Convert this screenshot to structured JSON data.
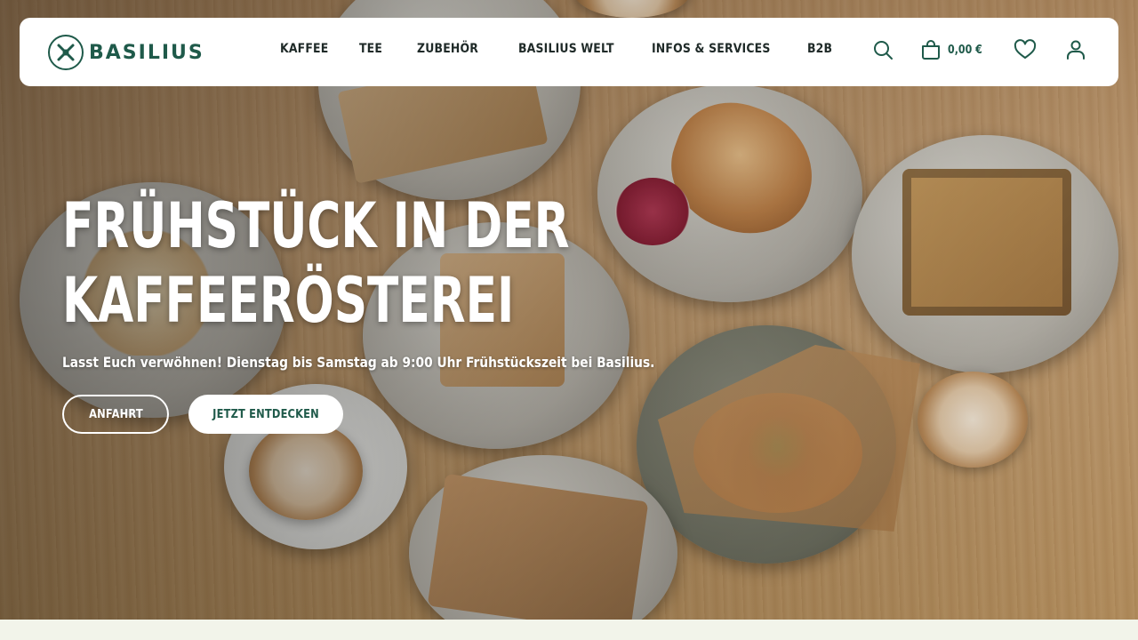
{
  "brand": {
    "name": "BASILIUS",
    "color": "#1f5a4a"
  },
  "nav": {
    "items": [
      {
        "label": "KAFFEE"
      },
      {
        "label": "TEE"
      },
      {
        "label": "ZUBEHÖR"
      },
      {
        "label": "BASILIUS WELT"
      },
      {
        "label": "INFOS & SERVICES"
      },
      {
        "label": "B2B"
      }
    ]
  },
  "actions": {
    "search_icon": "search-icon",
    "cart_icon": "basket-icon",
    "cart_amount": "0,00 €",
    "wishlist_icon": "heart-icon",
    "account_icon": "user-icon"
  },
  "hero": {
    "title_line1": "FRÜHSTÜCK IN DER",
    "title_line2": "KAFFEERÖSTEREI",
    "subtitle": "Lasst Euch verwöhnen! Dienstag bis Samstag ab 9:00 Uhr Frühstückszeit bei Basilius.",
    "button_primary": "ANFAHRT",
    "button_secondary": "JETZT ENTDECKEN"
  }
}
